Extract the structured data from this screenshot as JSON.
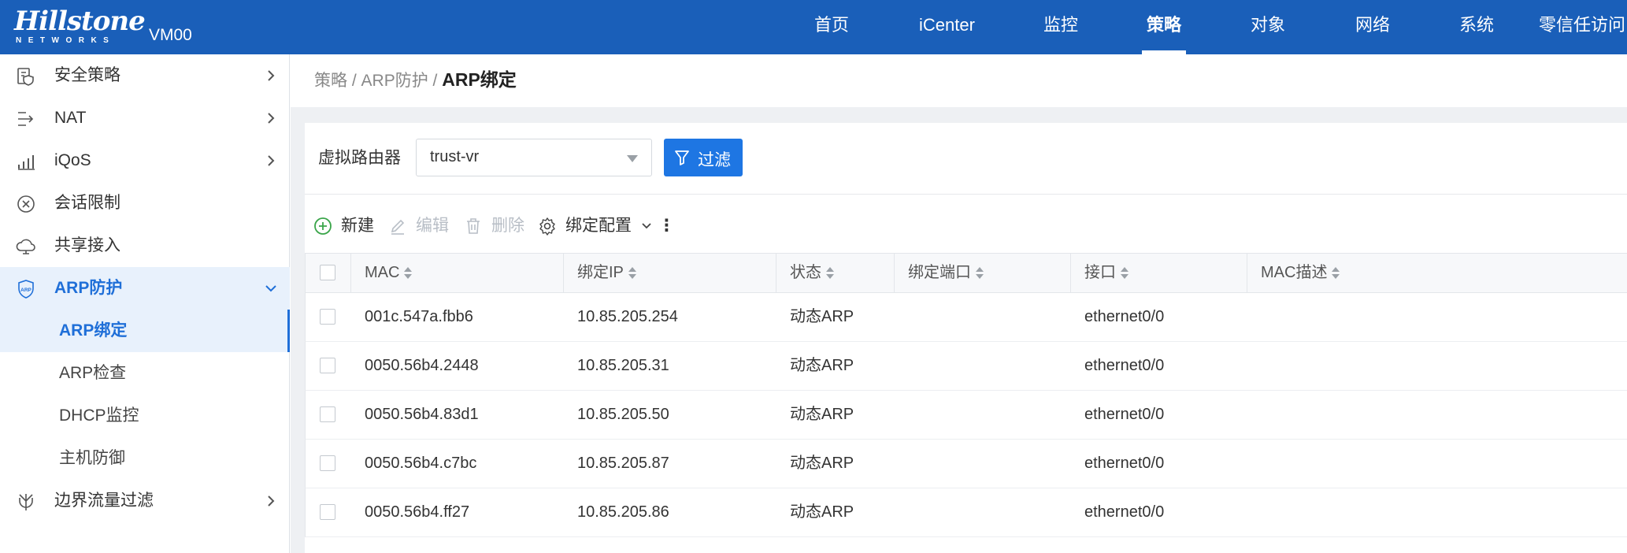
{
  "header": {
    "brand": "Hillstone",
    "brand_sub": "NETWORKS",
    "device": "VM00",
    "nav": [
      "首页",
      "iCenter",
      "监控",
      "策略",
      "对象",
      "网络",
      "系统",
      "零信任访问"
    ],
    "active_nav": "策略"
  },
  "sidebar": {
    "items": [
      {
        "label": "安全策略",
        "icon": "security-policy-icon"
      },
      {
        "label": "NAT",
        "icon": "nat-icon"
      },
      {
        "label": "iQoS",
        "icon": "iqos-icon"
      },
      {
        "label": "会话限制",
        "icon": "session-limit-icon"
      },
      {
        "label": "共享接入",
        "icon": "shared-access-icon"
      },
      {
        "label": "ARP防护",
        "icon": "arp-shield-icon"
      },
      {
        "label": "边界流量过滤",
        "icon": "border-filter-icon"
      }
    ],
    "sub_items": [
      "ARP绑定",
      "ARP检查",
      "DHCP监控",
      "主机防御"
    ],
    "active_sub": "ARP绑定"
  },
  "breadcrumb": {
    "part1": "策略",
    "part2": "ARP防护",
    "current": "ARP绑定",
    "separator": " / "
  },
  "filter": {
    "label": "虚拟路由器",
    "value": "trust-vr",
    "button": "过滤"
  },
  "toolbar": {
    "new": "新建",
    "edit": "编辑",
    "delete": "删除",
    "binding_config": "绑定配置",
    "more": "⋮"
  },
  "table": {
    "columns": [
      "MAC",
      "绑定IP",
      "状态",
      "绑定端口",
      "接口",
      "MAC描述"
    ],
    "rows": [
      {
        "mac": "001c.547a.fbb6",
        "ip": "10.85.205.254",
        "status": "动态ARP",
        "port": "",
        "iface": "ethernet0/0",
        "desc": ""
      },
      {
        "mac": "0050.56b4.2448",
        "ip": "10.85.205.31",
        "status": "动态ARP",
        "port": "",
        "iface": "ethernet0/0",
        "desc": ""
      },
      {
        "mac": "0050.56b4.83d1",
        "ip": "10.85.205.50",
        "status": "动态ARP",
        "port": "",
        "iface": "ethernet0/0",
        "desc": ""
      },
      {
        "mac": "0050.56b4.c7bc",
        "ip": "10.85.205.87",
        "status": "动态ARP",
        "port": "",
        "iface": "ethernet0/0",
        "desc": ""
      },
      {
        "mac": "0050.56b4.ff27",
        "ip": "10.85.205.86",
        "status": "动态ARP",
        "port": "",
        "iface": "ethernet0/0",
        "desc": ""
      }
    ]
  },
  "colors": {
    "header_bg": "#1a5fb9",
    "accent": "#1e76e3",
    "active_bg": "#e8f1fc",
    "add_green": "#3aa54a"
  }
}
